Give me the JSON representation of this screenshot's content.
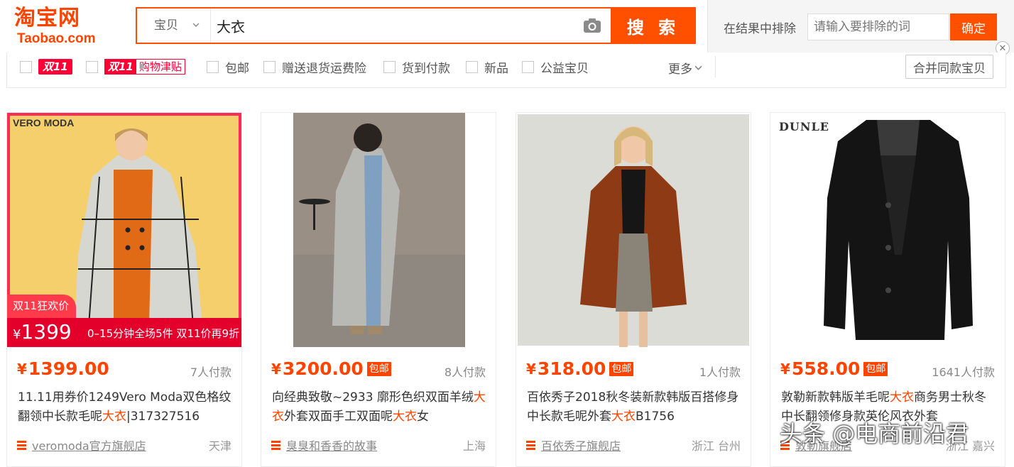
{
  "header": {
    "logo_main": "淘宝网",
    "logo_sub": "Taobao.com",
    "search": {
      "category": "宝贝",
      "query": "大衣",
      "button_label": "搜 索"
    },
    "exclude": {
      "label": "在结果中排除",
      "placeholder": "请输入要排除的词",
      "button_label": "确定"
    }
  },
  "filters": {
    "items": [
      {
        "type": "badge",
        "badge": "双11",
        "label": ""
      },
      {
        "type": "badge2",
        "badge": "双11",
        "label": "购物津贴"
      },
      {
        "type": "text",
        "label": "包邮"
      },
      {
        "type": "text",
        "label": "赠送退货运费险"
      },
      {
        "type": "text",
        "label": "货到付款"
      },
      {
        "type": "text",
        "label": "新品"
      },
      {
        "type": "text",
        "label": "公益宝贝"
      }
    ],
    "more_label": "更多",
    "merge_label": "合并同款宝贝"
  },
  "products": [
    {
      "price": "1399.00",
      "free_shipping": "",
      "sales": "7人付款",
      "title_parts": [
        {
          "text": "11.11用券价1249Vero Moda双色格纹翻领中长款毛呢",
          "hl": false
        },
        {
          "text": "大衣",
          "hl": true
        },
        {
          "text": "|317327516",
          "hl": false
        }
      ],
      "shop": "veromoda官方旗舰店",
      "location": "天津",
      "image": {
        "brand": "VERO MODA",
        "promo_title": "双11狂欢价",
        "promo_price_yen": "¥",
        "promo_price": "1399",
        "promo_note": "0–15分钟全场5件 双11价再9折"
      }
    },
    {
      "price": "3200.00",
      "free_shipping": "包邮",
      "sales": "8人付款",
      "title_parts": [
        {
          "text": "向经典致敬~2933 廓形色织双面羊绒",
          "hl": false
        },
        {
          "text": "大衣",
          "hl": true
        },
        {
          "text": "外套双面手工双面呢",
          "hl": false
        },
        {
          "text": "大衣",
          "hl": true
        },
        {
          "text": "女",
          "hl": false
        }
      ],
      "shop": "臭臭和香香的故事",
      "location": "上海",
      "image": {}
    },
    {
      "price": "318.00",
      "free_shipping": "包邮",
      "sales": "1人付款",
      "title_parts": [
        {
          "text": "百依秀子2018秋冬装新款韩版百搭修身中长款毛呢外套",
          "hl": false
        },
        {
          "text": "大衣",
          "hl": true
        },
        {
          "text": "B1756",
          "hl": false
        }
      ],
      "shop": "百依秀子旗舰店",
      "location": "浙江 台州",
      "image": {}
    },
    {
      "price": "558.00",
      "free_shipping": "包邮",
      "sales": "1641人付款",
      "title_parts": [
        {
          "text": "敦勒新款韩版羊毛呢",
          "hl": false
        },
        {
          "text": "大衣",
          "hl": true
        },
        {
          "text": "商务男士秋冬中长翻领修身款英伦风衣外套",
          "hl": false
        }
      ],
      "shop": "敦勒旗舰店",
      "location": "浙江 嘉兴",
      "image": {
        "brand": "DUNLE"
      }
    }
  ],
  "currency_symbol": "¥",
  "watermark": "头条 @电商前沿君",
  "colors": {
    "accent": "#ff5000",
    "price": "#ff4400",
    "double11": "#ff0036"
  }
}
